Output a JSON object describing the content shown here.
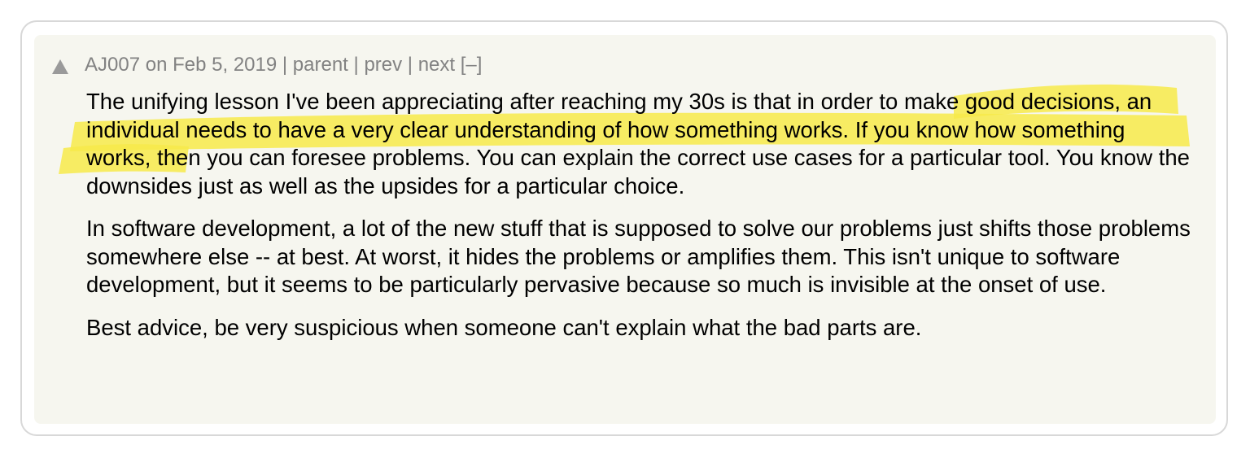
{
  "comment": {
    "author": "AJ007",
    "on_text": "on",
    "date": "Feb 5, 2019",
    "sep": "|",
    "parent_link": "parent",
    "prev_link": "prev",
    "next_link": "next",
    "collapse_toggle": "[–]",
    "paragraphs": [
      {
        "pre": "The unifying lesson I've been appreciating after reaching my 30s is that ",
        "highlight": "in order to make good decisions, an individual needs to have a very clear understanding of how something works.",
        "post": " If you know how something works, then you can foresee problems. You can explain the correct use cases for a particular tool. You know the downsides just as well as the upsides for a particular choice."
      },
      {
        "text": "In software development, a lot of the new stuff that is supposed to solve our problems just shifts those problems somewhere else -- at best. At worst, it hides the problems or amplifies them. This isn't unique to software development, but it seems to be particularly pervasive because so much is invisible at the onset of use."
      },
      {
        "text": "Best advice, be very suspicious when someone can't explain what the bad parts are."
      }
    ]
  },
  "colors": {
    "comment_bg": "#f6f6ef",
    "meta_text": "#828282",
    "highlight": "#f7ea4a",
    "card_border": "#d8d8d8"
  },
  "icons": {
    "vote": "upvote-triangle-icon"
  }
}
